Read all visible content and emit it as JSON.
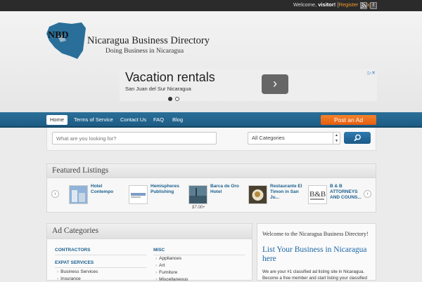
{
  "topbar": {
    "welcome_text": "Welcome, ",
    "user": "visitor!",
    "register": "Register",
    "separator": "|",
    "login": "Login",
    "icons": [
      "rss-icon",
      "twitter-icon"
    ]
  },
  "logo": {
    "initials": "NBD",
    "title": "Nicaragua Business Directory",
    "tagline": "Doing Business in Nicaragua",
    "color": "#2a6f99"
  },
  "ad": {
    "title": "Vacation rentals",
    "subtitle": "San Juan del Sur Nicaragua",
    "arrow": "›",
    "corner_icons": "▷✕"
  },
  "nav": {
    "items": [
      "Home",
      "Terms of Service",
      "Contact Us",
      "FAQ",
      "Blog"
    ],
    "active": "Home",
    "post_ad": "Post an Ad",
    "accent": "#1d5c84",
    "button_color": "#f5822a"
  },
  "search": {
    "placeholder": "What are you looking for?",
    "category_selected": "All Categories"
  },
  "featured": {
    "title": "Featured Listings",
    "prev": "‹",
    "next": "›",
    "listings": [
      {
        "name": "Hotel Contempo",
        "price": ""
      },
      {
        "name": "Hemispheres Publishing",
        "price": ""
      },
      {
        "name": "Barca de Oro Hotel",
        "price": "$7.00+"
      },
      {
        "name": "Restaurante El Timon in San Ju...",
        "price": ""
      },
      {
        "name": "B & B ATTORNEYS AND COUNS...",
        "price": ""
      }
    ]
  },
  "categories": {
    "title": "Ad Categories",
    "col1": [
      {
        "heading": "CONTRACTORS",
        "items": []
      },
      {
        "heading": "EXPAT SERVICES",
        "items": [
          "Business Services",
          "Insurance"
        ]
      }
    ],
    "col2": [
      {
        "heading": "MISC",
        "items": [
          "Appliances",
          "Art",
          "Furniture",
          "Miscellaneous"
        ]
      }
    ]
  },
  "welcome_box": {
    "heading": "Welcome to the Nicaragua Business Directory!",
    "link": "List Your Business in Nicaragua here",
    "text": "We are your #1 classified ad listing site in Nicaragua. Become a free member and start listing your classified"
  }
}
